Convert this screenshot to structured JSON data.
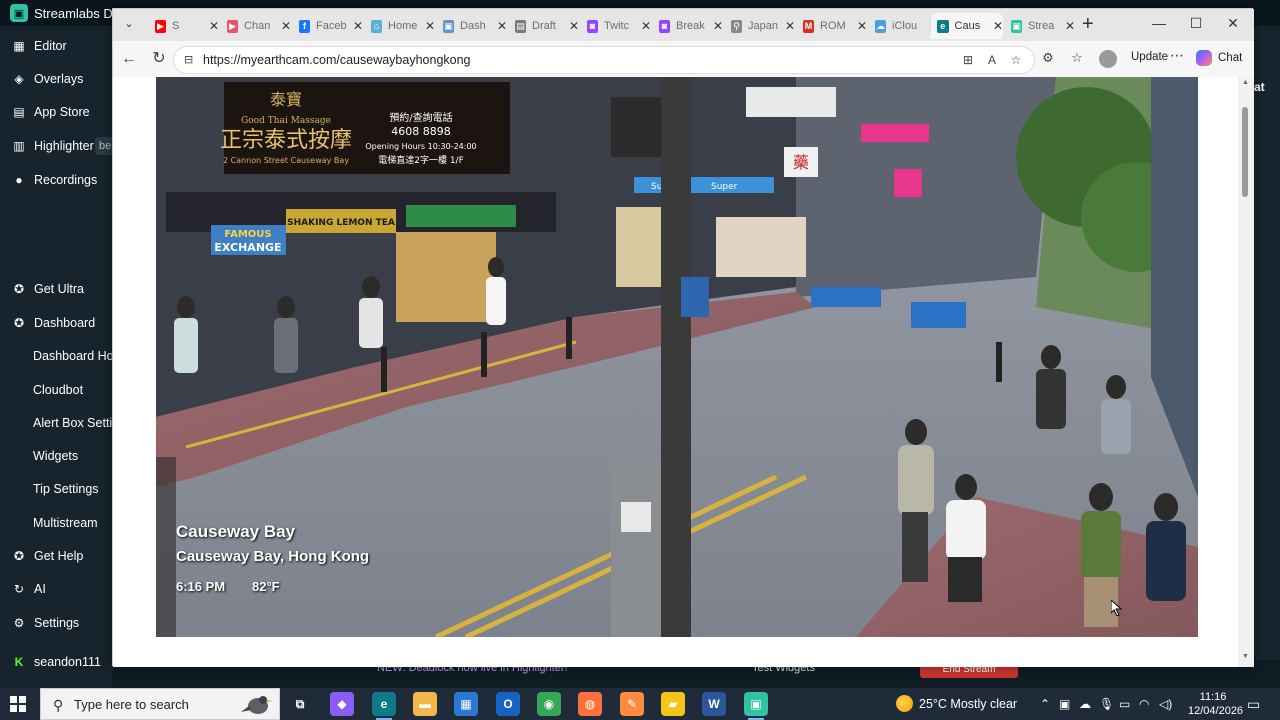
{
  "streamlabs": {
    "title": "Streamlabs De",
    "badge": "be",
    "right_edge_text": "at",
    "nav": [
      {
        "label": "Editor",
        "icon": "editor-icon",
        "glyph": "▦"
      },
      {
        "label": "Overlays",
        "icon": "overlays-icon",
        "glyph": "◈"
      },
      {
        "label": "App Store",
        "icon": "app-store-icon",
        "glyph": "▤"
      },
      {
        "label": "Highlighter",
        "icon": "highlighter-icon",
        "glyph": "▥"
      },
      {
        "label": "Recordings",
        "icon": "recordings-icon",
        "glyph": "●"
      },
      {
        "label": "Get Ultra",
        "icon": "ultra-icon",
        "glyph": "✪"
      },
      {
        "label": "Dashboard",
        "icon": "dashboard-icon",
        "glyph": "✪"
      },
      {
        "label": "Dashboard Hom",
        "icon": "",
        "glyph": ""
      },
      {
        "label": "Cloudbot",
        "icon": "",
        "glyph": ""
      },
      {
        "label": "Alert Box Settin",
        "icon": "",
        "glyph": ""
      },
      {
        "label": "Widgets",
        "icon": "",
        "glyph": ""
      },
      {
        "label": "Tip Settings",
        "icon": "",
        "glyph": ""
      },
      {
        "label": "Multistream",
        "icon": "",
        "glyph": ""
      },
      {
        "label": "Get Help",
        "icon": "help-icon",
        "glyph": "✪"
      },
      {
        "label": "AI",
        "icon": "ai-icon",
        "glyph": "↻"
      },
      {
        "label": "Settings",
        "icon": "settings-icon",
        "glyph": "⚙"
      },
      {
        "label": "seandon111",
        "icon": "kick-icon",
        "glyph": "K"
      }
    ],
    "bottom": {
      "news": "NEW: Deadlock now live in Highlighter!",
      "test_widgets": "Test Widgets",
      "end_stream": "End Stream"
    }
  },
  "browser": {
    "tabs": [
      {
        "title": "S",
        "favicon": "youtube-icon",
        "color": "#ff0000",
        "glyph": "▶"
      },
      {
        "title": "Chan",
        "favicon": "channel-icon",
        "color": "#e8556b",
        "glyph": "▶"
      },
      {
        "title": "Faceb",
        "favicon": "facebook-icon",
        "color": "#1877f2",
        "glyph": "f"
      },
      {
        "title": "Home",
        "favicon": "home-icon",
        "color": "#5ab0d8",
        "glyph": "⌂"
      },
      {
        "title": "Dash",
        "favicon": "dashboard-tab-icon",
        "color": "#6b8fd6",
        "glyph": "▣"
      },
      {
        "title": "Draft",
        "favicon": "draft-icon",
        "color": "#7a7a7a",
        "glyph": "▤"
      },
      {
        "title": "Twitc",
        "favicon": "twitch-icon",
        "color": "#9146ff",
        "glyph": "◙"
      },
      {
        "title": "Break",
        "favicon": "twitch-icon",
        "color": "#9146ff",
        "glyph": "◙"
      },
      {
        "title": "Japan",
        "favicon": "search-tab-icon",
        "color": "#8a8a8a",
        "glyph": "⚲"
      },
      {
        "title": "ROM",
        "favicon": "gmail-icon",
        "color": "#d93025",
        "glyph": "M"
      },
      {
        "title": "iClou",
        "favicon": "icloud-icon",
        "color": "#4a9fe0",
        "glyph": "☁"
      },
      {
        "title": "Caus",
        "favicon": "edge-tab-icon",
        "color": "#0f7a8a",
        "glyph": "e"
      },
      {
        "title": "Strea",
        "favicon": "streamlabs-tab-icon",
        "color": "#31c3a2",
        "glyph": "▣"
      }
    ],
    "active_tab_index": 11,
    "url": "https://myearthcam.com/causewaybayhongkong",
    "update_label": "Update",
    "chat_label": "Chat"
  },
  "cam": {
    "title": "Causeway Bay",
    "location": "Causeway Bay, Hong Kong",
    "time": "6:16 PM",
    "temp": "82°F"
  },
  "scene_signs": {
    "massage_cn": "泰寶",
    "massage_en": "Good Thai Massage",
    "massage_big": "正宗泰式按摩",
    "massage_addr": "2 Cannon Street Causeway Bay",
    "phone": "4608 8898",
    "booking": "預約/查詢電話",
    "hours": "Opening Hours 10:30-24:00",
    "floor": "電梯直達2字一樓 1/F",
    "lemon": "SHAKING LEMON TEA",
    "famous": "FAMOUS",
    "exchange": "EXCHANGE",
    "sugar": "Sugar",
    "super": "Super",
    "pharmacy": "藥"
  },
  "taskbar": {
    "search_placeholder": "Type here to search",
    "weather": "25°C  Mostly clear",
    "time": "11:16",
    "date": "12/04/2026",
    "apps": [
      {
        "name": "task-view-icon",
        "glyph": "⧉",
        "color": "transparent"
      },
      {
        "name": "copilot-icon",
        "glyph": "◆",
        "color": "#8b5cf6"
      },
      {
        "name": "edge-icon",
        "glyph": "e",
        "color": "#0f7a8a"
      },
      {
        "name": "file-explorer-icon",
        "glyph": "▬",
        "color": "#f2b84b"
      },
      {
        "name": "ms-store-icon",
        "glyph": "▦",
        "color": "#2a78d4"
      },
      {
        "name": "outlook-icon",
        "glyph": "O",
        "color": "#1565c0"
      },
      {
        "name": "chrome-icon",
        "glyph": "◉",
        "color": "#34a853"
      },
      {
        "name": "firefox-icon",
        "glyph": "◍",
        "color": "#ff7139"
      },
      {
        "name": "paint-icon",
        "glyph": "✎",
        "color": "#ff8a3d"
      },
      {
        "name": "sticky-notes-icon",
        "glyph": "▰",
        "color": "#f5c518"
      },
      {
        "name": "word-icon",
        "glyph": "W",
        "color": "#2b579a"
      },
      {
        "name": "streamlabs-icon",
        "glyph": "▣",
        "color": "#31c3a2"
      }
    ]
  }
}
